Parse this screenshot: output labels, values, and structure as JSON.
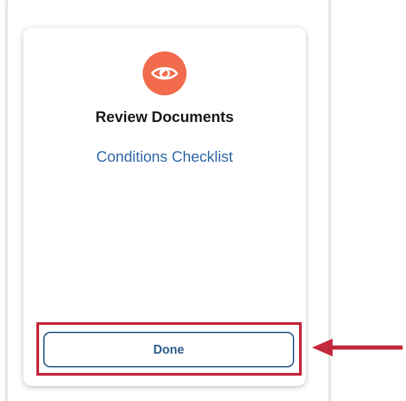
{
  "card": {
    "icon": "eye-icon",
    "title": "Review Documents",
    "link_label": "Conditions Checklist",
    "done_label": "Done"
  },
  "colors": {
    "icon_bg": "#f26b4d",
    "link": "#2e68a8",
    "button": "#2e5d8e",
    "annotation": "#c4283c"
  },
  "annotation": {
    "arrow_icon": "arrow-left-icon",
    "highlight": "done-button"
  }
}
